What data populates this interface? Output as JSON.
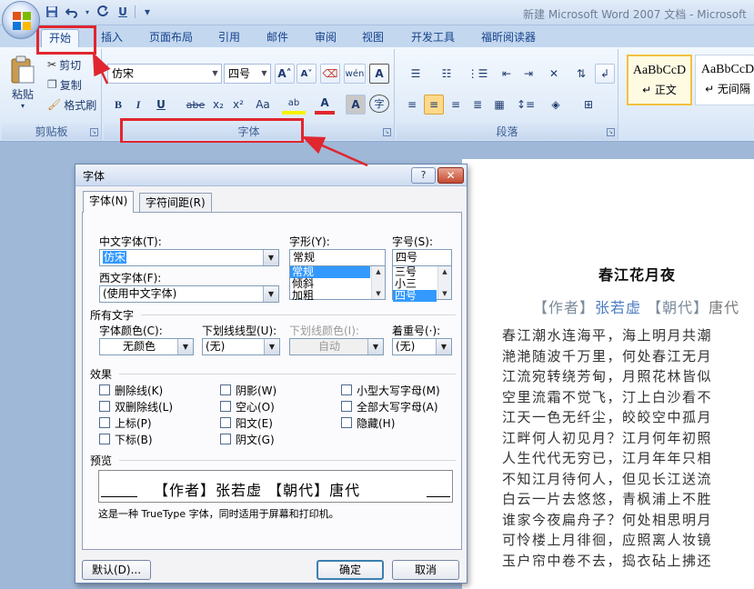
{
  "window": {
    "title": "新建 Microsoft Word 2007 文档 - Microsoft"
  },
  "qat": {
    "save": "save-icon",
    "undo": "undo-icon",
    "redo": "redo-icon",
    "underline": "U",
    "customize": "▾"
  },
  "tabs": [
    "开始",
    "插入",
    "页面布局",
    "引用",
    "邮件",
    "审阅",
    "视图",
    "开发工具",
    "福昕阅读器"
  ],
  "ribbon": {
    "clipboard": {
      "label": "剪贴板",
      "paste": "粘贴",
      "cut": "剪切",
      "copy": "复制",
      "format_painter": "格式刷"
    },
    "font": {
      "label": "字体",
      "font_name": "仿宋",
      "font_size": "四号",
      "grow": "A˄",
      "shrink": "A˅",
      "clear": "清",
      "phonetic": "wén",
      "border": "A",
      "bold": "B",
      "italic": "I",
      "underline": "U",
      "strike": "abe",
      "sub": "x₂",
      "sup": "x²",
      "case": "Aa",
      "highlight": "ab",
      "color": "A",
      "shade": "A",
      "circle": "字"
    },
    "paragraph": {
      "label": "段落"
    },
    "styles": [
      {
        "sample": "AaBbCcD",
        "name": "↵ 正文"
      },
      {
        "sample": "AaBbCcD",
        "name": "↵ 无间隔"
      }
    ]
  },
  "document": {
    "title": "春江花月夜",
    "meta": {
      "l1": "【作者】",
      "author": "张若虚",
      "l2": "【朝代】",
      "dynasty": "唐代"
    },
    "lines": [
      "春江潮水连海平，海上明月共潮",
      "滟滟随波千万里，何处春江无月",
      " 江流宛转绕芳甸，月照花林皆似",
      "空里流霜不觉飞，汀上白沙看不",
      "江天一色无纤尘，皎皎空中孤月",
      "江畔何人初见月？江月何年初照",
      "人生代代无穷已，江月年年只相",
      "不知江月待何人，但见长江送流",
      "白云一片去悠悠，青枫浦上不胜",
      "谁家今夜扁舟子？何处相思明月",
      "可怜楼上月徘徊，应照离人妆镜",
      "玉户帘中卷不去，捣衣砧上拂还"
    ]
  },
  "dialog": {
    "title": "字体",
    "help": "?",
    "close": "✕",
    "tabs": [
      "字体(N)",
      "字符间距(R)"
    ],
    "chinese_font_label": "中文字体(T):",
    "chinese_font_value": "仿宋",
    "western_font_label": "西文字体(F):",
    "western_font_value": "(使用中文字体)",
    "style_label": "字形(Y):",
    "style_value": "常规",
    "style_options": [
      "常规",
      "倾斜",
      "加粗"
    ],
    "size_label": "字号(S):",
    "size_value": "四号",
    "size_options": [
      "三号",
      "小三",
      "四号"
    ],
    "all_text": "所有文字",
    "font_color_label": "字体颜色(C):",
    "font_color_value": "无颜色",
    "underline_style_label": "下划线线型(U):",
    "underline_style_value": "(无)",
    "underline_color_label": "下划线颜色(I):",
    "underline_color_value": "自动",
    "emphasis_label": "着重号(·):",
    "emphasis_value": "(无)",
    "effects": "效果",
    "effect_items": [
      "删除线(K)",
      "双删除线(L)",
      "上标(P)",
      "下标(B)",
      "阴影(W)",
      "空心(O)",
      "阳文(E)",
      "阴文(G)",
      "小型大写字母(M)",
      "全部大写字母(A)",
      "隐藏(H)"
    ],
    "preview": "预览",
    "preview_text": "【作者】张若虚  【朝代】唐代",
    "info": "这是一种 TrueType 字体，同时适用于屏幕和打印机。",
    "default_btn": "默认(D)...",
    "ok_btn": "确定",
    "cancel_btn": "取消"
  },
  "colors": {
    "annotation_red": "#e0262f",
    "ribbon_text": "#15428b"
  }
}
